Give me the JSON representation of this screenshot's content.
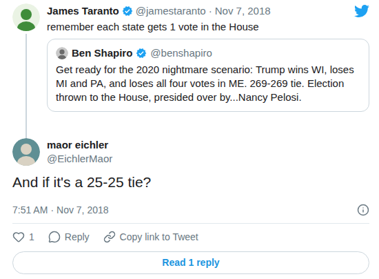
{
  "parent": {
    "name": "James Taranto",
    "verified": true,
    "handle": "@jamestaranto",
    "separator": "·",
    "date": "Nov 7, 2018",
    "text": "remember each state gets 1 vote in the House"
  },
  "quoted": {
    "name": "Ben Shapiro",
    "verified": true,
    "handle": "@benshapiro",
    "text": "Get ready for the 2020 nightmare scenario: Trump wins WI, loses MI and PA, and loses all four votes in ME. 269-269 tie. Election thrown to the House, presided over by...Nancy Pelosi."
  },
  "main": {
    "name": "maor eichler",
    "verified": false,
    "handle": "@EichlerMaor",
    "text": "And if it's a 25-25 tie?",
    "time": "7:51 AM",
    "separator": "·",
    "date": "Nov 7, 2018"
  },
  "actions": [
    {
      "kind": "like",
      "label": "1"
    },
    {
      "kind": "reply",
      "label": "Reply"
    },
    {
      "kind": "copy",
      "label": "Copy link to Tweet"
    }
  ],
  "read_replies": "Read 1 reply"
}
